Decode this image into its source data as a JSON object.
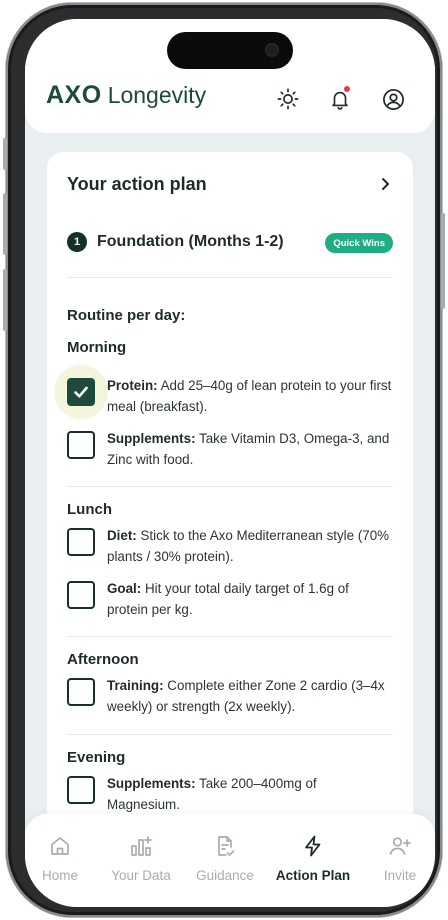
{
  "header": {
    "logo_axo": "AXO",
    "logo_longevity": "Longevity"
  },
  "card": {
    "title": "Your action plan",
    "phase_number": "1",
    "phase_label": "Foundation (Months 1-2)",
    "badge": "Quick Wins",
    "routine_label": "Routine per day:",
    "sections": {
      "morning": "Morning",
      "lunch": "Lunch",
      "afternoon": "Afternoon",
      "evening": "Evening"
    },
    "items": [
      {
        "bold": "Protein:",
        "text": " Add 25–40g of lean protein to your first meal (breakfast).",
        "checked": true
      },
      {
        "bold": "Supplements:",
        "text": " Take Vitamin D3, Omega-3, and Zinc with food.",
        "checked": false
      },
      {
        "bold": "Diet:",
        "text": " Stick to the Axo Mediterranean style (70% plants / 30% protein).",
        "checked": false
      },
      {
        "bold": "Goal:",
        "text": " Hit your total daily target of 1.6g of protein per kg.",
        "checked": false
      },
      {
        "bold": "Training:",
        "text": " Complete either Zone 2 cardio (3–4x weekly) or strength (2x weekly).",
        "checked": false
      },
      {
        "bold": "Supplements:",
        "text": " Take 200–400mg of Magnesium.",
        "checked": false
      }
    ]
  },
  "nav": {
    "home": "Home",
    "your_data": "Your Data",
    "guidance": "Guidance",
    "action_plan": "Action Plan",
    "invite": "Invite"
  },
  "colors": {
    "brand": "#1d4a3c",
    "badge": "#1fae84",
    "notification": "#e23b3b",
    "background": "#e9eef1"
  }
}
